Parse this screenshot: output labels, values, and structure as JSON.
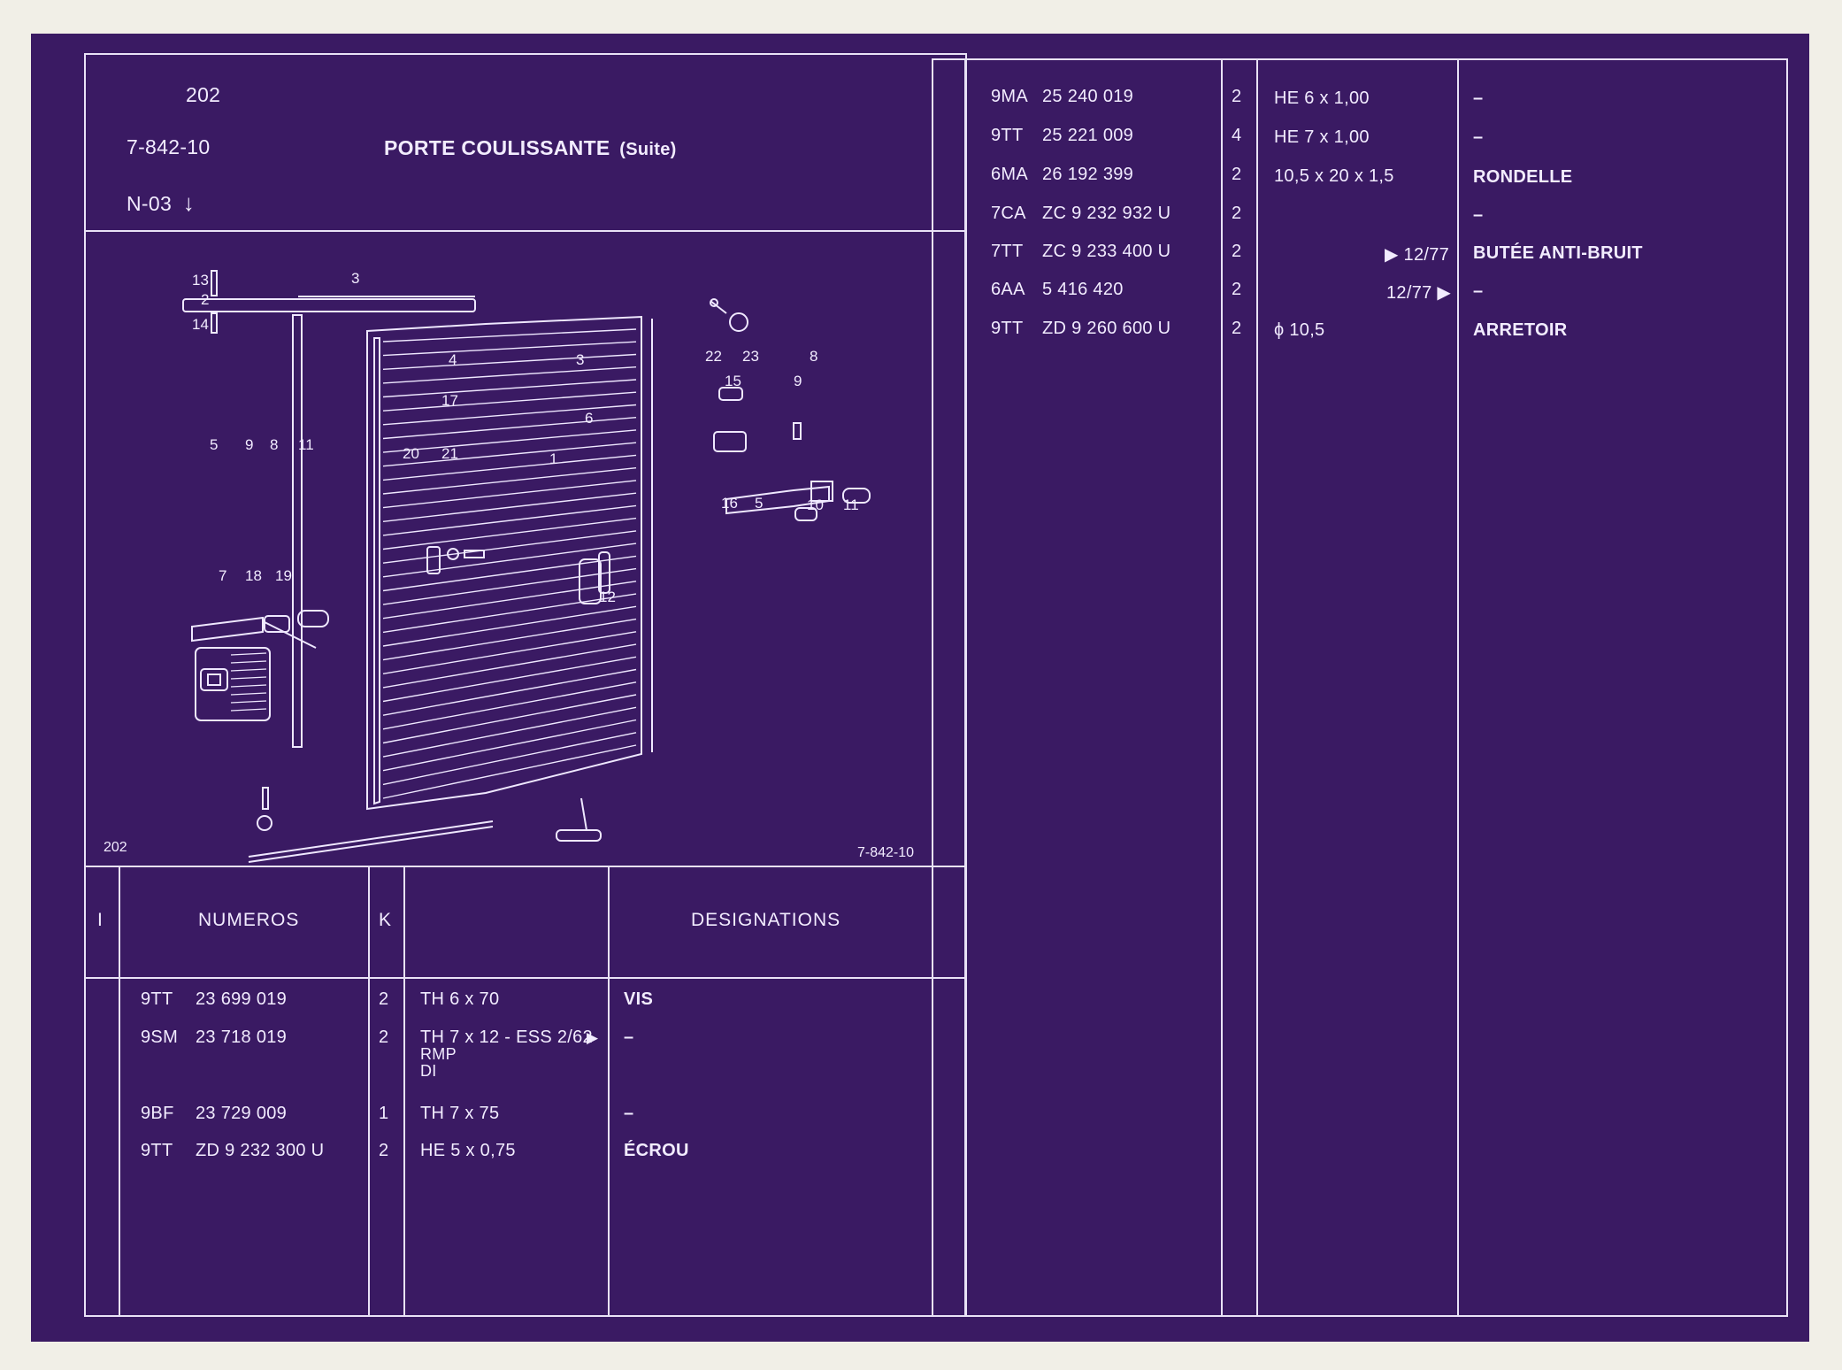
{
  "header": {
    "model": "202",
    "plate_ref": "7-842-10",
    "section": "N-03",
    "section_arrow": "↓",
    "title": "PORTE COULISSANTE",
    "title_suffix": "(Suite)"
  },
  "diagram": {
    "caption_left": "202",
    "caption_right": "7-842-10",
    "callouts": [
      "13",
      "3",
      "2",
      "14",
      "4",
      "3",
      "22",
      "23",
      "8",
      "15",
      "9",
      "17",
      "6",
      "5",
      "9",
      "8",
      "11",
      "20",
      "21",
      "1",
      "16",
      "5",
      "10",
      "11",
      "7",
      "18",
      "19",
      "12"
    ]
  },
  "table_header": {
    "col_i": "I",
    "col_numeros": "NUMEROS",
    "col_k": "K",
    "col_designations": "DESIGNATIONS"
  },
  "left_rows": [
    {
      "code": "9TT",
      "number": "23  699  019",
      "k": "2",
      "spec": "TH 6 x 70",
      "spec_lines": [],
      "flag": "",
      "desig": "VIS"
    },
    {
      "code": "9SM",
      "number": "23  718  019",
      "k": "2",
      "spec": "TH 7 x 12 - ESS  2/62",
      "spec_lines": [
        "RMP",
        "DI"
      ],
      "flag": "▶",
      "desig": "–"
    },
    {
      "code": "9BF",
      "number": "23  729  009",
      "k": "1",
      "spec": "TH 7 x 75",
      "spec_lines": [],
      "flag": "",
      "desig": "–"
    },
    {
      "code": "9TT",
      "number": "ZD  9  232  300  U",
      "k": "2",
      "spec": "HE 5 x 0,75",
      "spec_lines": [],
      "flag": "",
      "desig": "ÉCROU"
    }
  ],
  "right_rows": [
    {
      "code": "9MA",
      "number": "25  240  019",
      "k": "2",
      "spec": "HE 6 x  1,00",
      "date": "",
      "desig": "–"
    },
    {
      "code": "9TT",
      "number": "25  221  009",
      "k": "4",
      "spec": "HE 7 x  1,00",
      "date": "",
      "desig": "–"
    },
    {
      "code": "6MA",
      "number": "26  192  399",
      "k": "2",
      "spec": "10,5 x 20 x 1,5",
      "date": "",
      "desig": "RONDELLE"
    },
    {
      "code": "7CA",
      "number": "ZC  9  232  932  U",
      "k": "2",
      "spec": "",
      "date": "",
      "desig": "–"
    },
    {
      "code": "7TT",
      "number": "ZC  9  233  400  U",
      "k": "2",
      "spec": "",
      "date": "▶ 12/77",
      "desig": "BUTÉE ANTI-BRUIT"
    },
    {
      "code": "6AA",
      "number": "5  416  420",
      "k": "2",
      "spec": "",
      "date": "12/77 ▶",
      "desig": "–"
    },
    {
      "code": "9TT",
      "number": "ZD  9  260  600  U",
      "k": "2",
      "spec": "ϕ  10,5",
      "date": "",
      "desig": "ARRETOIR"
    }
  ],
  "colors": {
    "background": "#3a1a63",
    "lines": "#e9e2f6",
    "paper": "#f1efe7"
  }
}
